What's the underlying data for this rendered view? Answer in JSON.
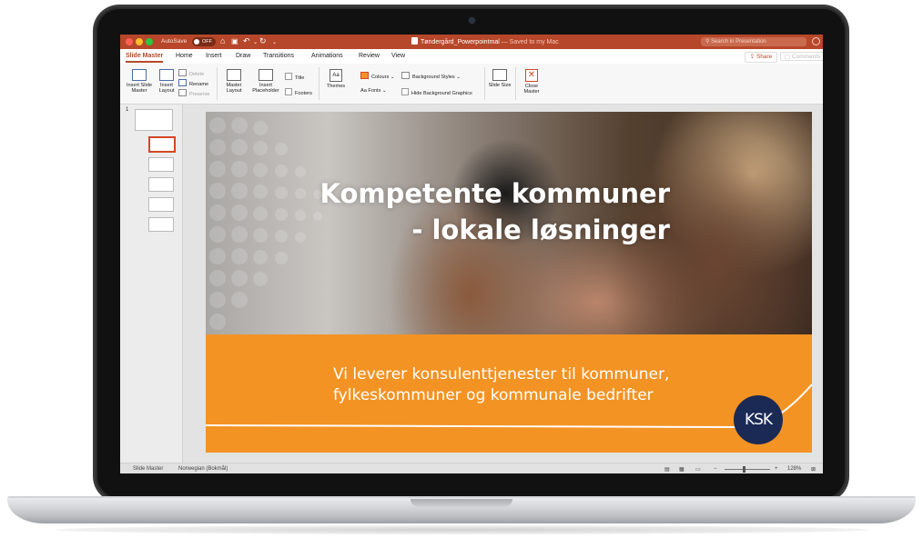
{
  "titlebar": {
    "autosave_label": "AutoSave",
    "autosave_state": "OFF",
    "doc_name": "Tøndergård_Powerpointmal",
    "doc_status": "— Saved to my Mac",
    "search_placeholder": "Search in Presentation",
    "icons": [
      "home-icon",
      "save-icon",
      "undo-icon",
      "redo-icon",
      "customize-icon"
    ]
  },
  "tabs": [
    "Slide Master",
    "Home",
    "Insert",
    "Draw",
    "Transitions",
    "Animations",
    "Review",
    "View"
  ],
  "share_label": "Share",
  "comments_label": "Comments",
  "ribbon": {
    "insert_slide_master": "Insert Slide Master",
    "insert_layout": "Insert Layout",
    "delete": "Delete",
    "rename": "Rename",
    "preserve": "Preserve",
    "master_layout": "Master Layout",
    "insert_placeholder": "Insert Placeholder",
    "title": "Title",
    "footers": "Footers",
    "themes": "Themes",
    "colours": "Colours",
    "fonts": "Fonts",
    "background_styles": "Background Styles",
    "hide_background_graphics": "Hide Background Graphics",
    "slide_size": "Slide Size",
    "close_master": "Close Master"
  },
  "thumbnails": {
    "master_number": "1",
    "layout_count": 5,
    "selected_index": 0
  },
  "slide": {
    "title_line1": "Kompetente kommuner",
    "title_line2": "- lokale løsninger",
    "subtitle_line1": "Vi leverer konsulenttjenester til kommuner,",
    "subtitle_line2": "fylkeskommuner og kommunale bedrifter",
    "logo_text": "KSK",
    "accent_color": "#f39324",
    "logo_color": "#1b2a55"
  },
  "statusbar": {
    "view": "Slide Master",
    "language": "Norwegian (Bokmål)",
    "zoom": "128%"
  },
  "colors": {
    "titlebar": "#b7472a"
  }
}
